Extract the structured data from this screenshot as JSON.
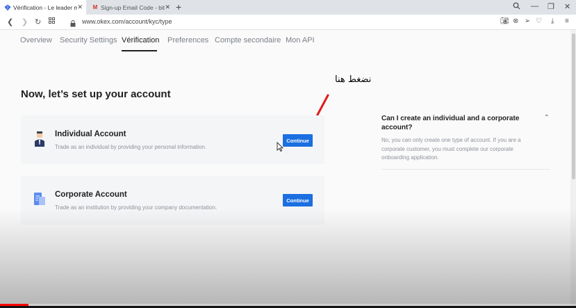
{
  "browser": {
    "tabs": [
      {
        "title": "Vérification - Le leader mo",
        "active": true,
        "icon": "okex-diamond-icon"
      },
      {
        "title": "Sign-up Email Code - bitco",
        "active": false,
        "icon": "gmail-icon"
      }
    ],
    "url": "www.okex.com/account/kyc/type"
  },
  "subnav": {
    "items": [
      "Overview",
      "Security Settings",
      "Vérification",
      "Preferences",
      "Compte secondaire",
      "Mon API"
    ],
    "active": "Vérification"
  },
  "main": {
    "heading": "Now, let’s set up your account",
    "annotation": "نضغط هنا",
    "cards": [
      {
        "title": "Individual Account",
        "description": "Trade as an individual by providing your personal information.",
        "button": "Continue",
        "icon": "person-icon"
      },
      {
        "title": "Corporate Account",
        "description": "Trade as an institution by providing your company documentation.",
        "button": "Continue",
        "icon": "document-icon"
      }
    ]
  },
  "faq": {
    "question": "Can I create an individual and a corporate account?",
    "answer": "No, you can only create one type of account. If you are a corporate customer, you must complete our corporate onboarding application.",
    "expanded": true
  },
  "video": {
    "progress": 0.05
  },
  "colors": {
    "accent": "#1b6fe0",
    "annotation_arrow": "#e01b1b",
    "progress": "#ff0000"
  }
}
